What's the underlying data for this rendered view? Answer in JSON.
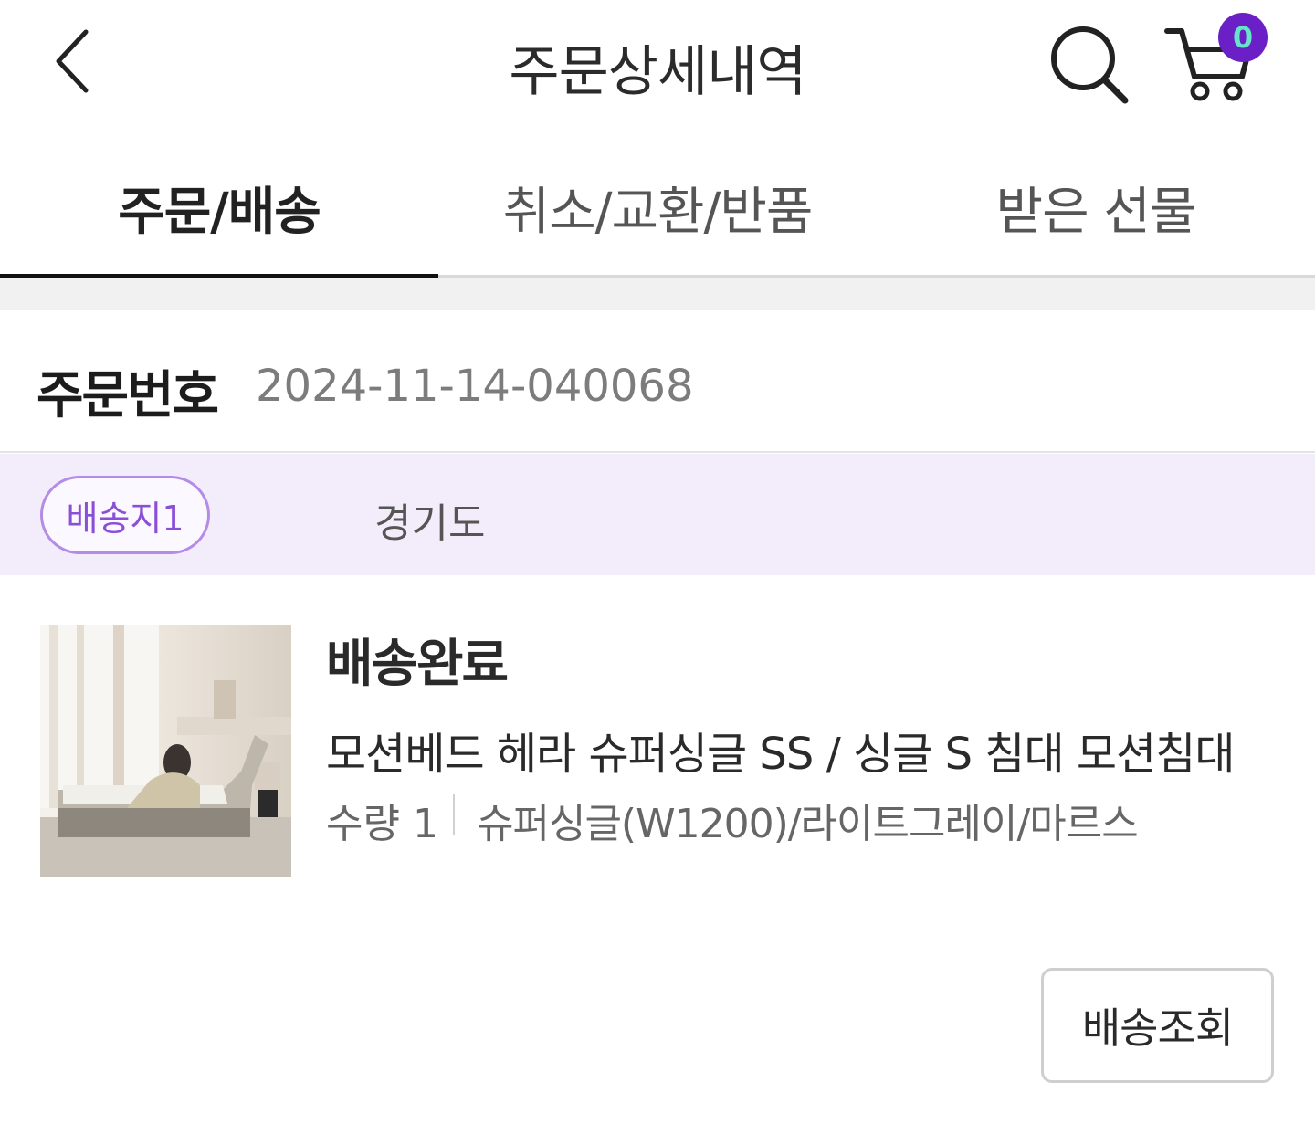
{
  "header": {
    "title": "주문상세내역",
    "back_icon": "chevron-left-icon",
    "search_icon": "search-icon",
    "cart_icon": "cart-icon",
    "cart_count": "0",
    "badge_color": "#6b1fc7"
  },
  "tabs": [
    {
      "label": "주문/배송",
      "active": true
    },
    {
      "label": "취소/교환/반품",
      "active": false
    },
    {
      "label": "받은 선물",
      "active": false
    }
  ],
  "order": {
    "label": "주문번호",
    "number": "2024-11-14-040068"
  },
  "destination": {
    "badge": "배송지1",
    "address": "경기도"
  },
  "product": {
    "status": "배송완료",
    "name": "모션베드 헤라 슈퍼싱글 SS / 싱글 S 침대 모션침대",
    "quantity": "수량 1",
    "option": "슈퍼싱글(W1200)/라이트그레이/마르스"
  },
  "actions": {
    "track_label": "배송조회"
  }
}
